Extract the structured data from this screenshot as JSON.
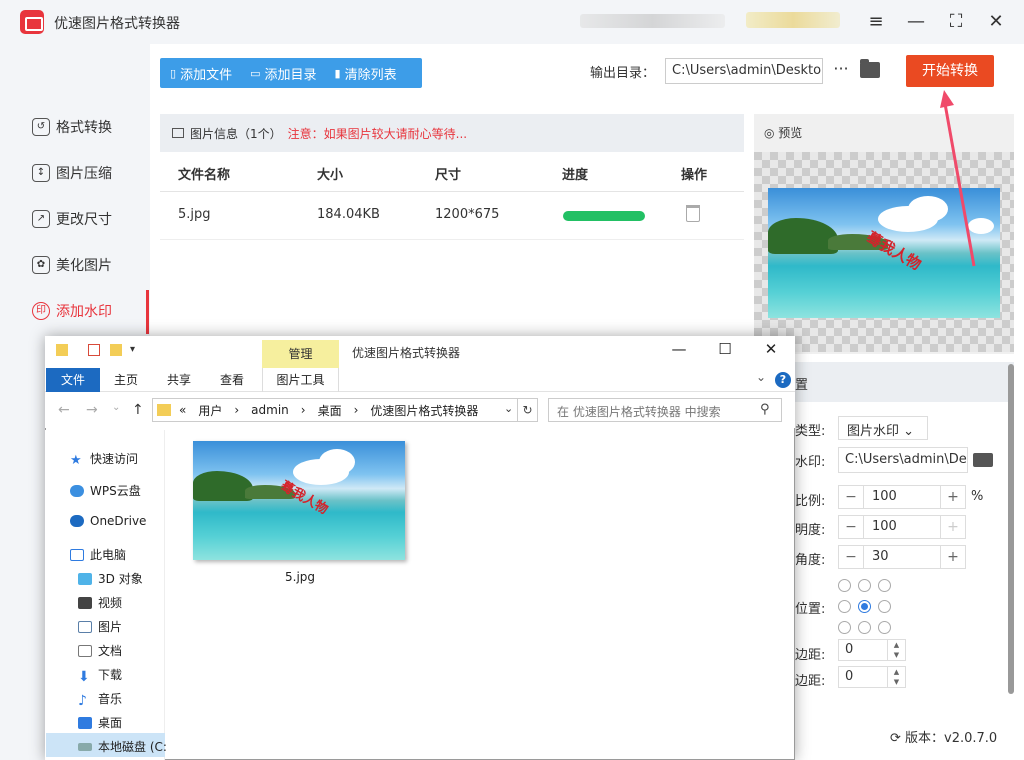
{
  "app": {
    "title": "优速图片格式转换器"
  },
  "window_controls": {
    "menu": "≡",
    "minimize": "—",
    "maximize": "⛶",
    "close": "✕"
  },
  "sidebar": {
    "items": [
      {
        "label": "格式转换",
        "icon": "format-convert-icon"
      },
      {
        "label": "图片压缩",
        "icon": "compress-icon"
      },
      {
        "label": "更改尺寸",
        "icon": "resize-icon"
      },
      {
        "label": "美化图片",
        "icon": "beautify-icon"
      },
      {
        "label": "添加水印",
        "icon": "watermark-icon",
        "active": true
      }
    ],
    "accent": "#e8353d"
  },
  "toolbar": {
    "add_file": "添加文件",
    "add_dir": "添加目录",
    "clear_list": "清除列表",
    "output_label": "输出目录：",
    "output_path": "C:\\Users\\admin\\Desktop",
    "more": "···",
    "start": "开始转换"
  },
  "info": {
    "title": "图片信息（1个）",
    "warning": "注意：如果图片较大请耐心等待..."
  },
  "table": {
    "headers": [
      "文件名称",
      "大小",
      "尺寸",
      "进度",
      "操作"
    ],
    "rows": [
      {
        "name": "5.jpg",
        "size": "184.04KB",
        "dims": "1200*675",
        "progress": 1.0
      }
    ]
  },
  "preview": {
    "label": "预览",
    "watermark_text": "蓦我人物"
  },
  "settings": {
    "head": "置",
    "type_label": "类型:",
    "type_value": "图片水印",
    "watermark_label": "水印:",
    "watermark_path": "C:\\Users\\admin\\De",
    "scale_label": "比例:",
    "scale_value": "100",
    "scale_unit": "%",
    "opacity_label": "明度:",
    "opacity_value": "100",
    "angle_label": "角度:",
    "angle_value": "30",
    "position_label": "位置:",
    "position_selected": "middle-center",
    "margin1_label": "边距:",
    "margin1_value": "0",
    "margin2_label": "边距:",
    "margin2_value": "0"
  },
  "version": "版本：v2.0.7.0",
  "explorer": {
    "manage_tab": "管理",
    "title": "优速图片格式转换器",
    "ribbon_tabs": [
      "文件",
      "主页",
      "共享",
      "查看",
      "图片工具"
    ],
    "path": [
      "用户",
      "admin",
      "桌面",
      "优速图片格式转换器"
    ],
    "path_prefix": "«",
    "search_placeholder": "在 优速图片格式转换器 中搜索",
    "nav_items": [
      {
        "label": "快速访问",
        "icon": "star-icon"
      },
      {
        "label": "WPS云盘",
        "icon": "cloud-icon"
      },
      {
        "label": "OneDrive",
        "icon": "onedrive-icon"
      },
      {
        "label": "此电脑",
        "icon": "computer-icon"
      },
      {
        "label": "3D 对象",
        "icon": "cube-icon"
      },
      {
        "label": "视频",
        "icon": "video-icon"
      },
      {
        "label": "图片",
        "icon": "picture-icon"
      },
      {
        "label": "文档",
        "icon": "document-icon"
      },
      {
        "label": "下载",
        "icon": "download-icon"
      },
      {
        "label": "音乐",
        "icon": "music-icon"
      },
      {
        "label": "桌面",
        "icon": "desktop-icon"
      },
      {
        "label": "本地磁盘 (C:",
        "icon": "disk-icon",
        "selected": true
      }
    ],
    "files": [
      {
        "name": "5.jpg"
      }
    ]
  }
}
